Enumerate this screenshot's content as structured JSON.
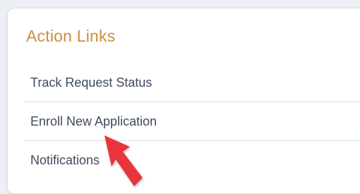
{
  "panel": {
    "title": "Action Links",
    "title_color": "#c8903e",
    "links": [
      {
        "label": "Track Request Status"
      },
      {
        "label": "Enroll New Application"
      },
      {
        "label": "Notifications"
      }
    ]
  },
  "annotation": {
    "icon": "red-arrow-pointer-icon",
    "color": "#e8353b"
  }
}
